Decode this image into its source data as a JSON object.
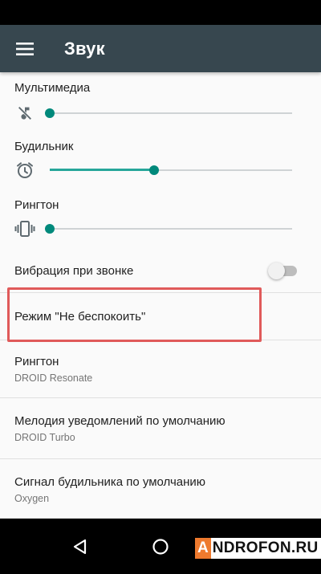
{
  "app_bar": {
    "title": "Звук",
    "menu_icon": "hamburger-menu-icon"
  },
  "volumes": [
    {
      "label": "Мультимедиа",
      "icon": "music-muted-icon",
      "level_percent": 0
    },
    {
      "label": "Будильник",
      "icon": "alarm-clock-icon",
      "level_percent": 43
    },
    {
      "label": "Рингтон",
      "icon": "vibrate-icon",
      "level_percent": 0
    }
  ],
  "vibration": {
    "label": "Вибрация при звонке",
    "enabled": false
  },
  "dnd": {
    "label": "Режим \"Не беспокоить\""
  },
  "ringtone": {
    "title": "Рингтон",
    "value": "DROID Resonate"
  },
  "notification_sound": {
    "title": "Мелодия уведомлений по умолчанию",
    "value": "DROID Turbo"
  },
  "alarm_sound": {
    "title": "Сигнал будильника по умолчанию",
    "value": "Oxygen"
  },
  "nav": {
    "back_icon": "back-triangle-icon",
    "home_icon": "home-circle-icon",
    "recents_icon": "recents-square-icon"
  },
  "watermark": {
    "first_letter": "A",
    "rest": "NDROFON.RU"
  },
  "colors": {
    "app_bar": "#37474f",
    "accent": "#00897b",
    "highlight": "#e05a5a"
  }
}
